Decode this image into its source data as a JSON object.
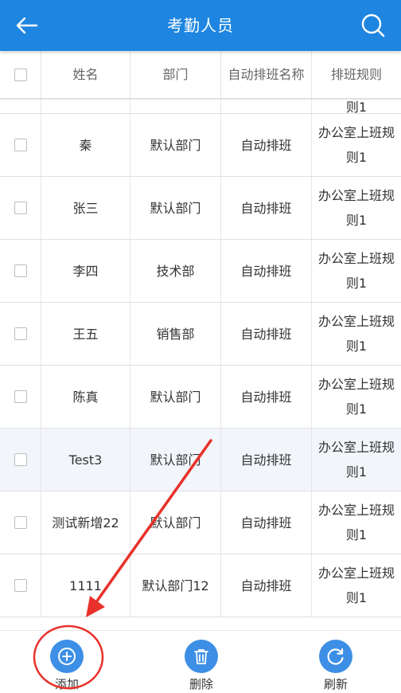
{
  "header": {
    "title": "考勤人员",
    "back_icon": "arrow-left-icon",
    "search_icon": "search-icon"
  },
  "table": {
    "columns": [
      "姓名",
      "部门",
      "自动排班名称",
      "排班规则"
    ],
    "partial_row_rule": "则1",
    "rows": [
      {
        "name": "秦",
        "dept": "默认部门",
        "schedule": "自动排班",
        "rule_line1": "办公室上班规",
        "rule_line2": "则1"
      },
      {
        "name": "张三",
        "dept": "默认部门",
        "schedule": "自动排班",
        "rule_line1": "办公室上班规",
        "rule_line2": "则1"
      },
      {
        "name": "李四",
        "dept": "技术部",
        "schedule": "自动排班",
        "rule_line1": "办公室上班规",
        "rule_line2": "则1"
      },
      {
        "name": "王五",
        "dept": "销售部",
        "schedule": "自动排班",
        "rule_line1": "办公室上班规",
        "rule_line2": "则1"
      },
      {
        "name": "陈真",
        "dept": "默认部门",
        "schedule": "自动排班",
        "rule_line1": "办公室上班规",
        "rule_line2": "则1"
      },
      {
        "name": "Test3",
        "dept": "默认部门",
        "schedule": "自动排班",
        "rule_line1": "办公室上班规",
        "rule_line2": "则1"
      },
      {
        "name": "测试新增22",
        "dept": "默认部门",
        "schedule": "自动排班",
        "rule_line1": "办公室上班规",
        "rule_line2": "则1"
      },
      {
        "name": "1111",
        "dept": "默认部门12",
        "schedule": "自动排班",
        "rule_line1": "办公室上班规",
        "rule_line2": "则1"
      }
    ]
  },
  "toolbar": {
    "add_label": "添加",
    "delete_label": "删除",
    "refresh_label": "刷新"
  },
  "colors": {
    "header_bg": "#1e86e0",
    "button_bg": "#3d8fe6",
    "annotation": "#e8312a",
    "highlight_row": "#f2f6fa"
  }
}
